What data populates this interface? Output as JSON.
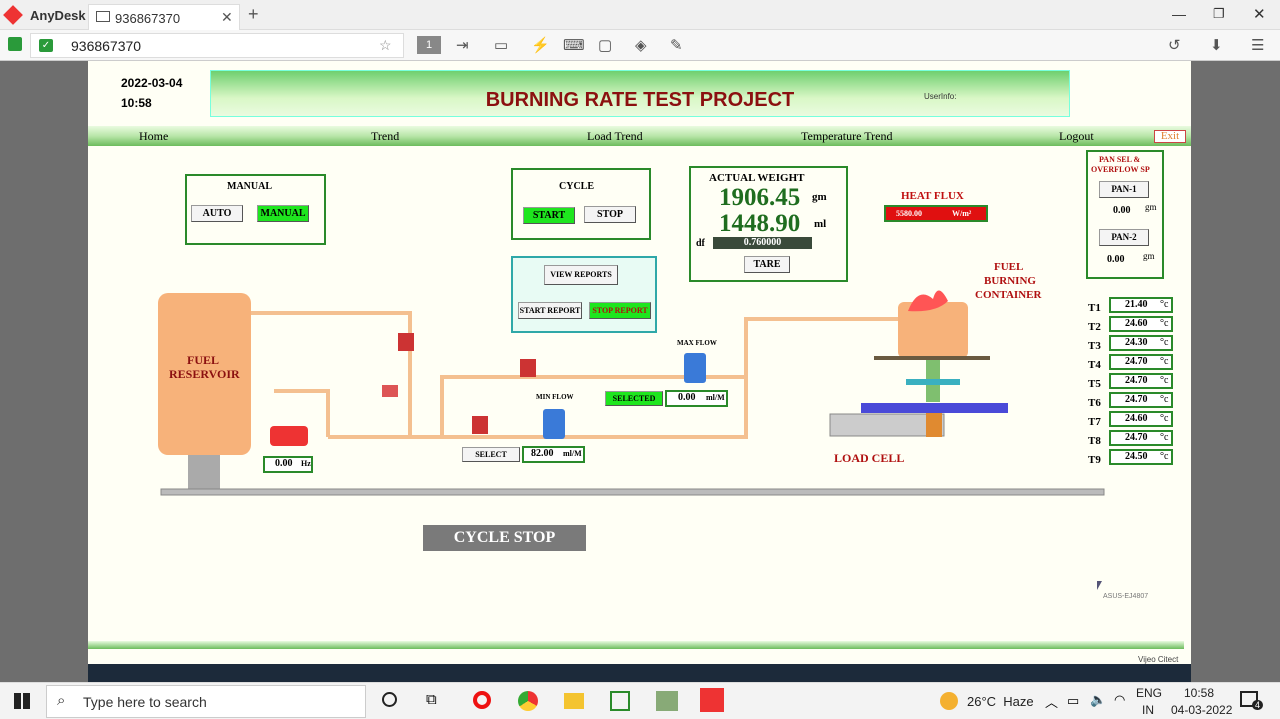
{
  "anydesk": {
    "app_name": "AnyDesk",
    "tab_label": "936867370",
    "address": "936867370",
    "toolbar_page": "1",
    "window_controls": [
      "minimize",
      "maximize",
      "close"
    ]
  },
  "hmi": {
    "date": "2022-03-04",
    "time": "10:58",
    "title": "BURNING RATE TEST PROJECT",
    "user_info": "UserInfo:",
    "nav": [
      "Home",
      "Trend",
      "Load Trend",
      "Temperature Trend",
      "Logout"
    ],
    "exit": "Exit",
    "manual": {
      "title": "MANUAL",
      "auto": "AUTO",
      "manual": "MANUAL"
    },
    "cycle": {
      "title": "CYCLE",
      "start": "START",
      "stop": "STOP"
    },
    "reports": {
      "view": "VIEW REPORTS",
      "start": "START REPORT",
      "stop": "STOP REPORT"
    },
    "weight": {
      "title": "ACTUAL WEIGHT",
      "value1": "1906.45",
      "unit1": "gm",
      "value2": "1448.90",
      "unit2": "ml",
      "df_label": "df",
      "df_value": "0.760000",
      "tare": "TARE"
    },
    "heat_flux": {
      "title": "HEAT FLUX",
      "value": "5580.00",
      "unit": "W/m²"
    },
    "pan": {
      "title_line1": "PAN SEL &",
      "title_line2": "OVERFLOW SP",
      "pan1": "PAN-1",
      "pan1_value": "0.00",
      "pan1_unit": "gm",
      "pan2": "PAN-2",
      "pan2_value": "0.00",
      "pan2_unit": "gm"
    },
    "container": {
      "line1": "FUEL",
      "line2": "BURNING",
      "line3": "CONTAINER"
    },
    "temps": [
      {
        "label": "T1",
        "value": "21.40"
      },
      {
        "label": "T2",
        "value": "24.60"
      },
      {
        "label": "T3",
        "value": "24.30"
      },
      {
        "label": "T4",
        "value": "24.70"
      },
      {
        "label": "T5",
        "value": "24.70"
      },
      {
        "label": "T6",
        "value": "24.70"
      },
      {
        "label": "T7",
        "value": "24.60"
      },
      {
        "label": "T8",
        "value": "24.70"
      },
      {
        "label": "T9",
        "value": "24.50"
      }
    ],
    "temp_unit": "°c",
    "reservoir": {
      "line1": "FUEL",
      "line2": "RESERVOIR"
    },
    "pump": {
      "value": "0.00",
      "unit": "Hz"
    },
    "min_flow": {
      "label": "MIN FLOW",
      "select": "SELECT",
      "value": "82.00",
      "unit": "ml/M"
    },
    "max_flow": {
      "label": "MAX FLOW",
      "select": "SELECTED",
      "value": "0.00",
      "unit": "ml/M"
    },
    "load_cell": "LOAD CELL",
    "status": "CYCLE STOP",
    "machine": "ASUS-EJ4807",
    "brand": "Vijeo Citect"
  },
  "taskbar": {
    "search": "Type here to search",
    "weather": "26°C  Haze",
    "lang1": "ENG",
    "lang2": "IN",
    "time": "10:58",
    "date": "04-03-2022",
    "notif": "4"
  },
  "colors": {
    "title": "#8b1010",
    "panel_border": "#2a8a2a",
    "active": "#1ee61e",
    "heat_flux": "#e01010"
  }
}
